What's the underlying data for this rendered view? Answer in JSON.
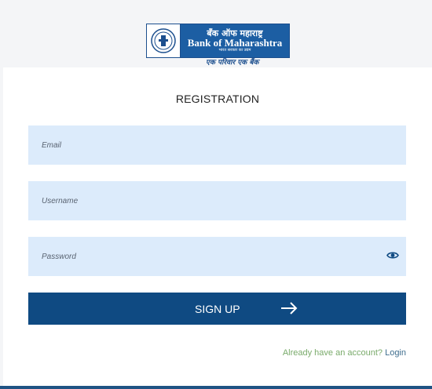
{
  "logo": {
    "name_hindi": "बँक ऑफ महाराष्ट्र",
    "name_english": "Bank of Maharashtra",
    "subtitle_hindi": "भारत सरकार का उद्यम",
    "tagline": "एक परिवार एक बैंक"
  },
  "form": {
    "title": "REGISTRATION",
    "email_placeholder": "Email",
    "username_placeholder": "Username",
    "password_placeholder": "Password",
    "submit_label": "SIGN UP"
  },
  "footer": {
    "question": "Already have an account?",
    "login_label": "Login"
  },
  "colors": {
    "primary": "#0f4a82",
    "field_bg": "#dcebfb",
    "question_text": "#7aab6b"
  },
  "icons": {
    "submit": "arrow-right-icon",
    "password_toggle": "eye-icon",
    "logo": "bank-emblem-icon"
  }
}
